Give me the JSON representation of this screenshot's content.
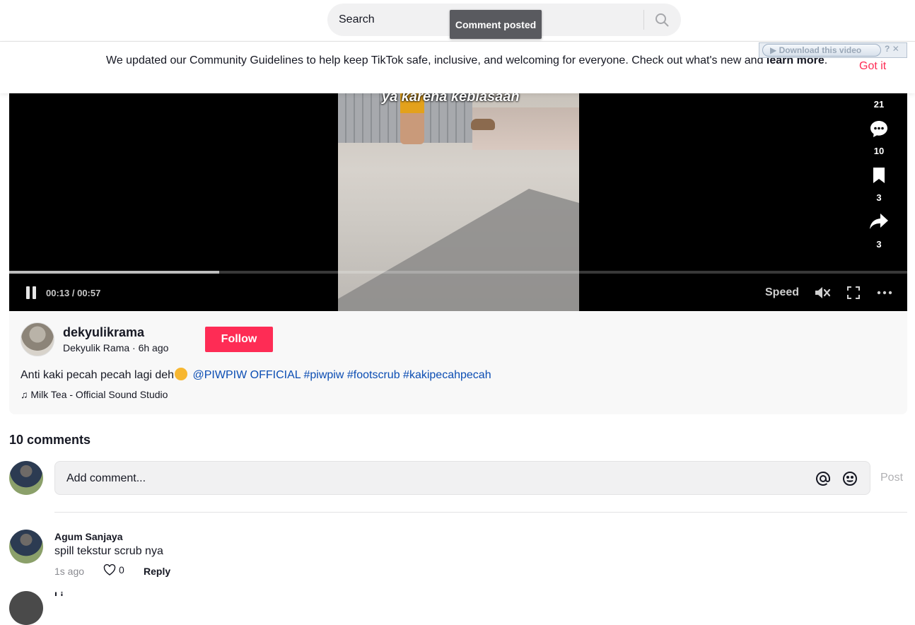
{
  "header": {
    "search_placeholder": "Search",
    "toast": "Comment posted"
  },
  "banner": {
    "text": "We updated our Community Guidelines to help keep TikTok safe, inclusive, and welcoming for everyone. Check out what's new and ",
    "link_text": "learn more",
    "period": ".",
    "got_it": "Got it",
    "download_label": "Download this video",
    "download_help": "?",
    "download_close": "✕"
  },
  "player": {
    "caption": "ya karena kebiasaan",
    "time": "00:13 / 00:57",
    "progress": 0.234,
    "speed_label": "Speed"
  },
  "actions": {
    "likes": "21",
    "comments": "10",
    "saves": "3",
    "shares": "3"
  },
  "author": {
    "username": "dekyulikrama",
    "display_name": "Dekyulik Rama",
    "posted": "6h ago",
    "separator": " · ",
    "follow_label": "Follow"
  },
  "description": {
    "text": "Anti kaki pecah pecah lagi deh",
    "mention": "@PIWPIW OFFICIAL",
    "hashtags": [
      "#piwpiw",
      "#footscrub",
      "#kakipecahpecah"
    ]
  },
  "music": {
    "note": "♫",
    "title": "Milk Tea - Official Sound Studio"
  },
  "comments_section": {
    "count_label": "10 comments",
    "input_placeholder": "Add comment...",
    "post_label": "Post",
    "items": [
      {
        "author": "Agum Sanjaya",
        "text": "spill tekstur scrub nya",
        "time": "1s ago",
        "likes": "0",
        "reply_label": "Reply"
      },
      {
        "author": "Li"
      }
    ]
  },
  "colors": {
    "brand_red": "#fe2c55",
    "link_blue": "#0b4db3"
  }
}
